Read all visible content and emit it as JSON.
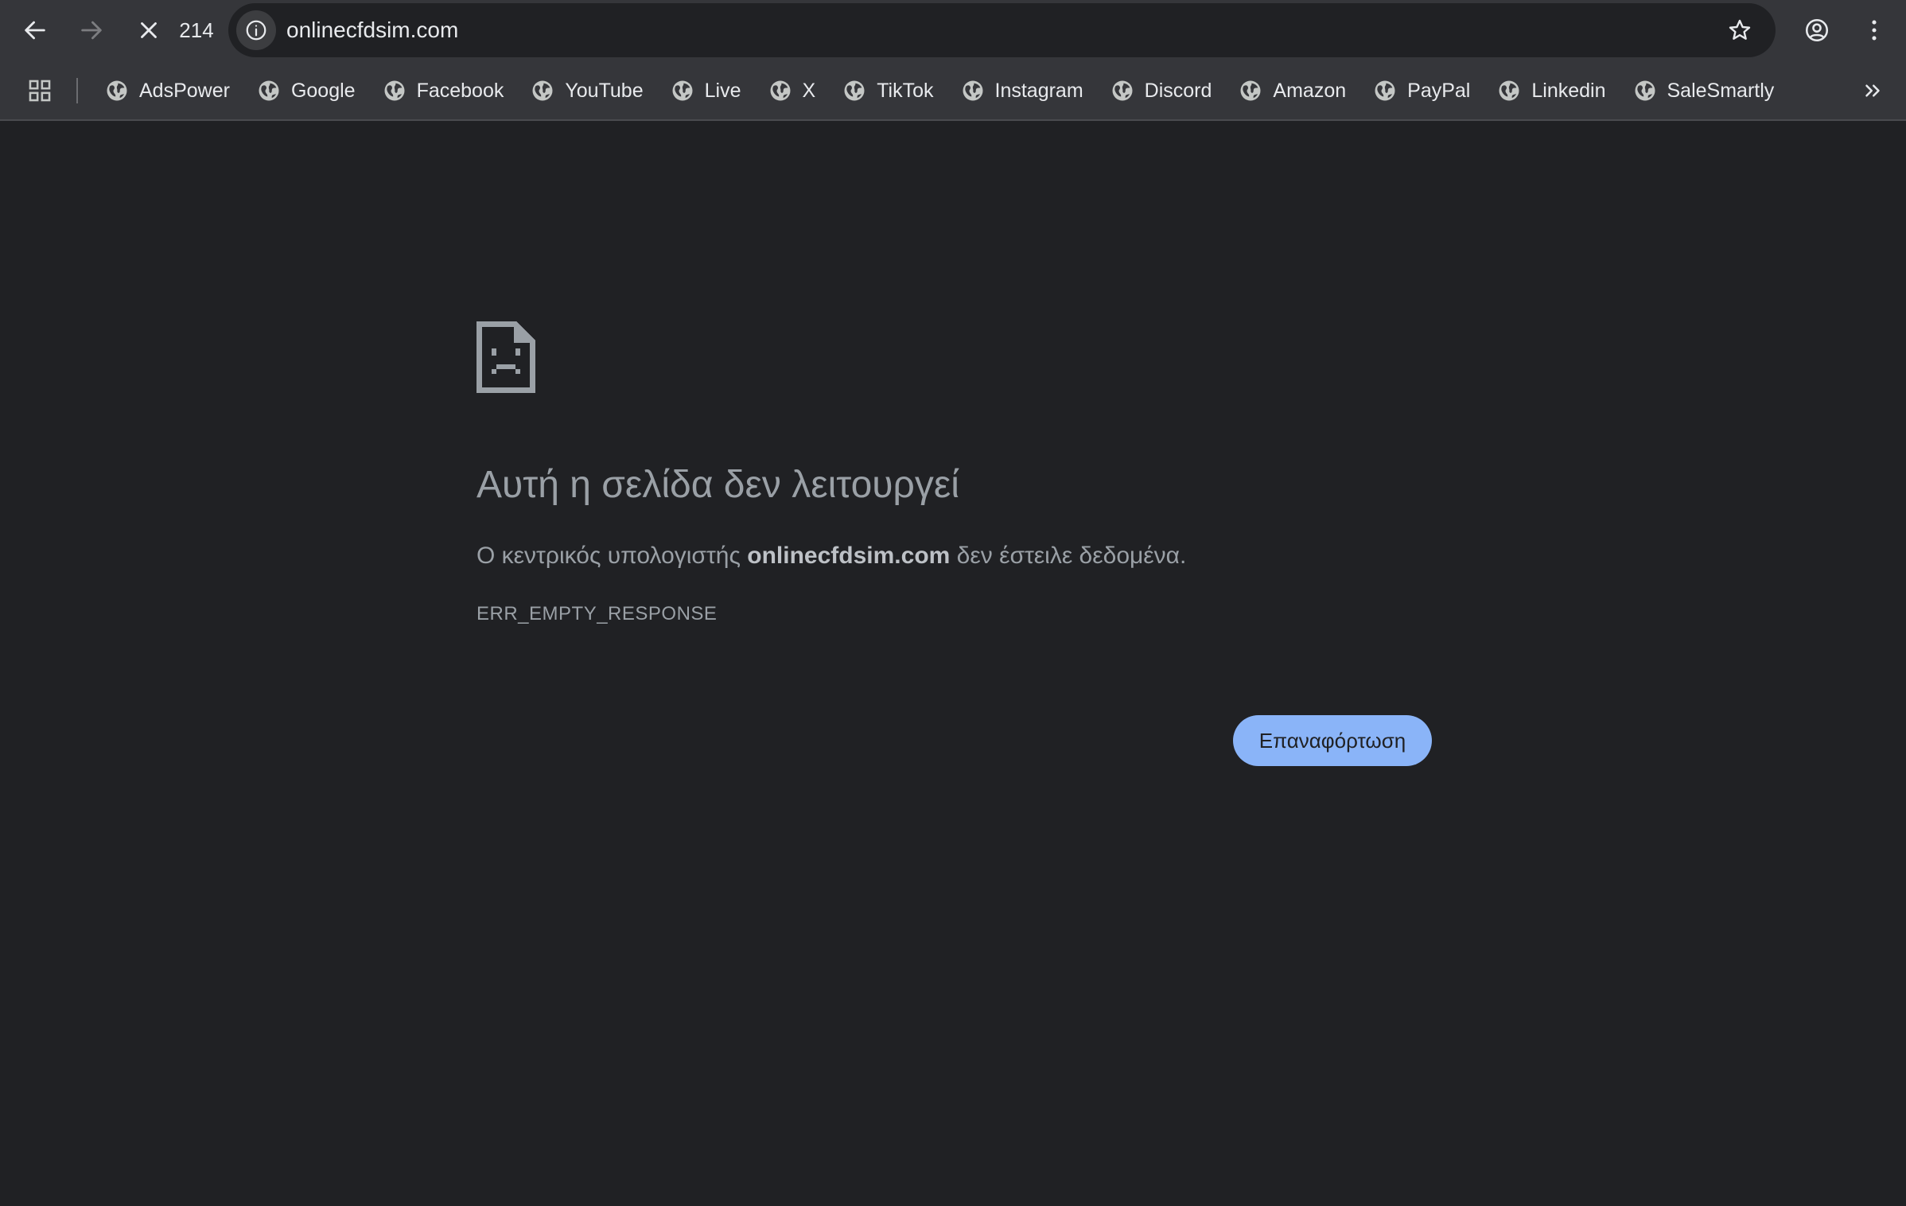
{
  "toolbar": {
    "tab_count": "214",
    "url": "onlinecfdsim.com",
    "icons": [
      "back-icon",
      "forward-icon",
      "stop-icon",
      "info-icon",
      "star-icon",
      "profile-icon",
      "menu-icon"
    ]
  },
  "bookmarks": [
    {
      "label": "AdsPower"
    },
    {
      "label": "Google"
    },
    {
      "label": "Facebook"
    },
    {
      "label": "YouTube"
    },
    {
      "label": "Live"
    },
    {
      "label": "X"
    },
    {
      "label": "TikTok"
    },
    {
      "label": "Instagram"
    },
    {
      "label": "Discord"
    },
    {
      "label": "Amazon"
    },
    {
      "label": "PayPal"
    },
    {
      "label": "Linkedin"
    },
    {
      "label": "SaleSmartly"
    }
  ],
  "error": {
    "title": "Αυτή η σελίδα δεν λειτουργεί",
    "desc_prefix": "Ο κεντρικός υπολογιστής ",
    "desc_host": "onlinecfdsim.com",
    "desc_suffix": " δεν έστειλε δεδομένα.",
    "code": "ERR_EMPTY_RESPONSE",
    "reload_label": "Επαναφόρτωση"
  },
  "colors": {
    "page_bg": "#202124",
    "toolbar_bg": "#35363a",
    "accent": "#8ab4f8",
    "text_muted": "#9aa0a6"
  }
}
